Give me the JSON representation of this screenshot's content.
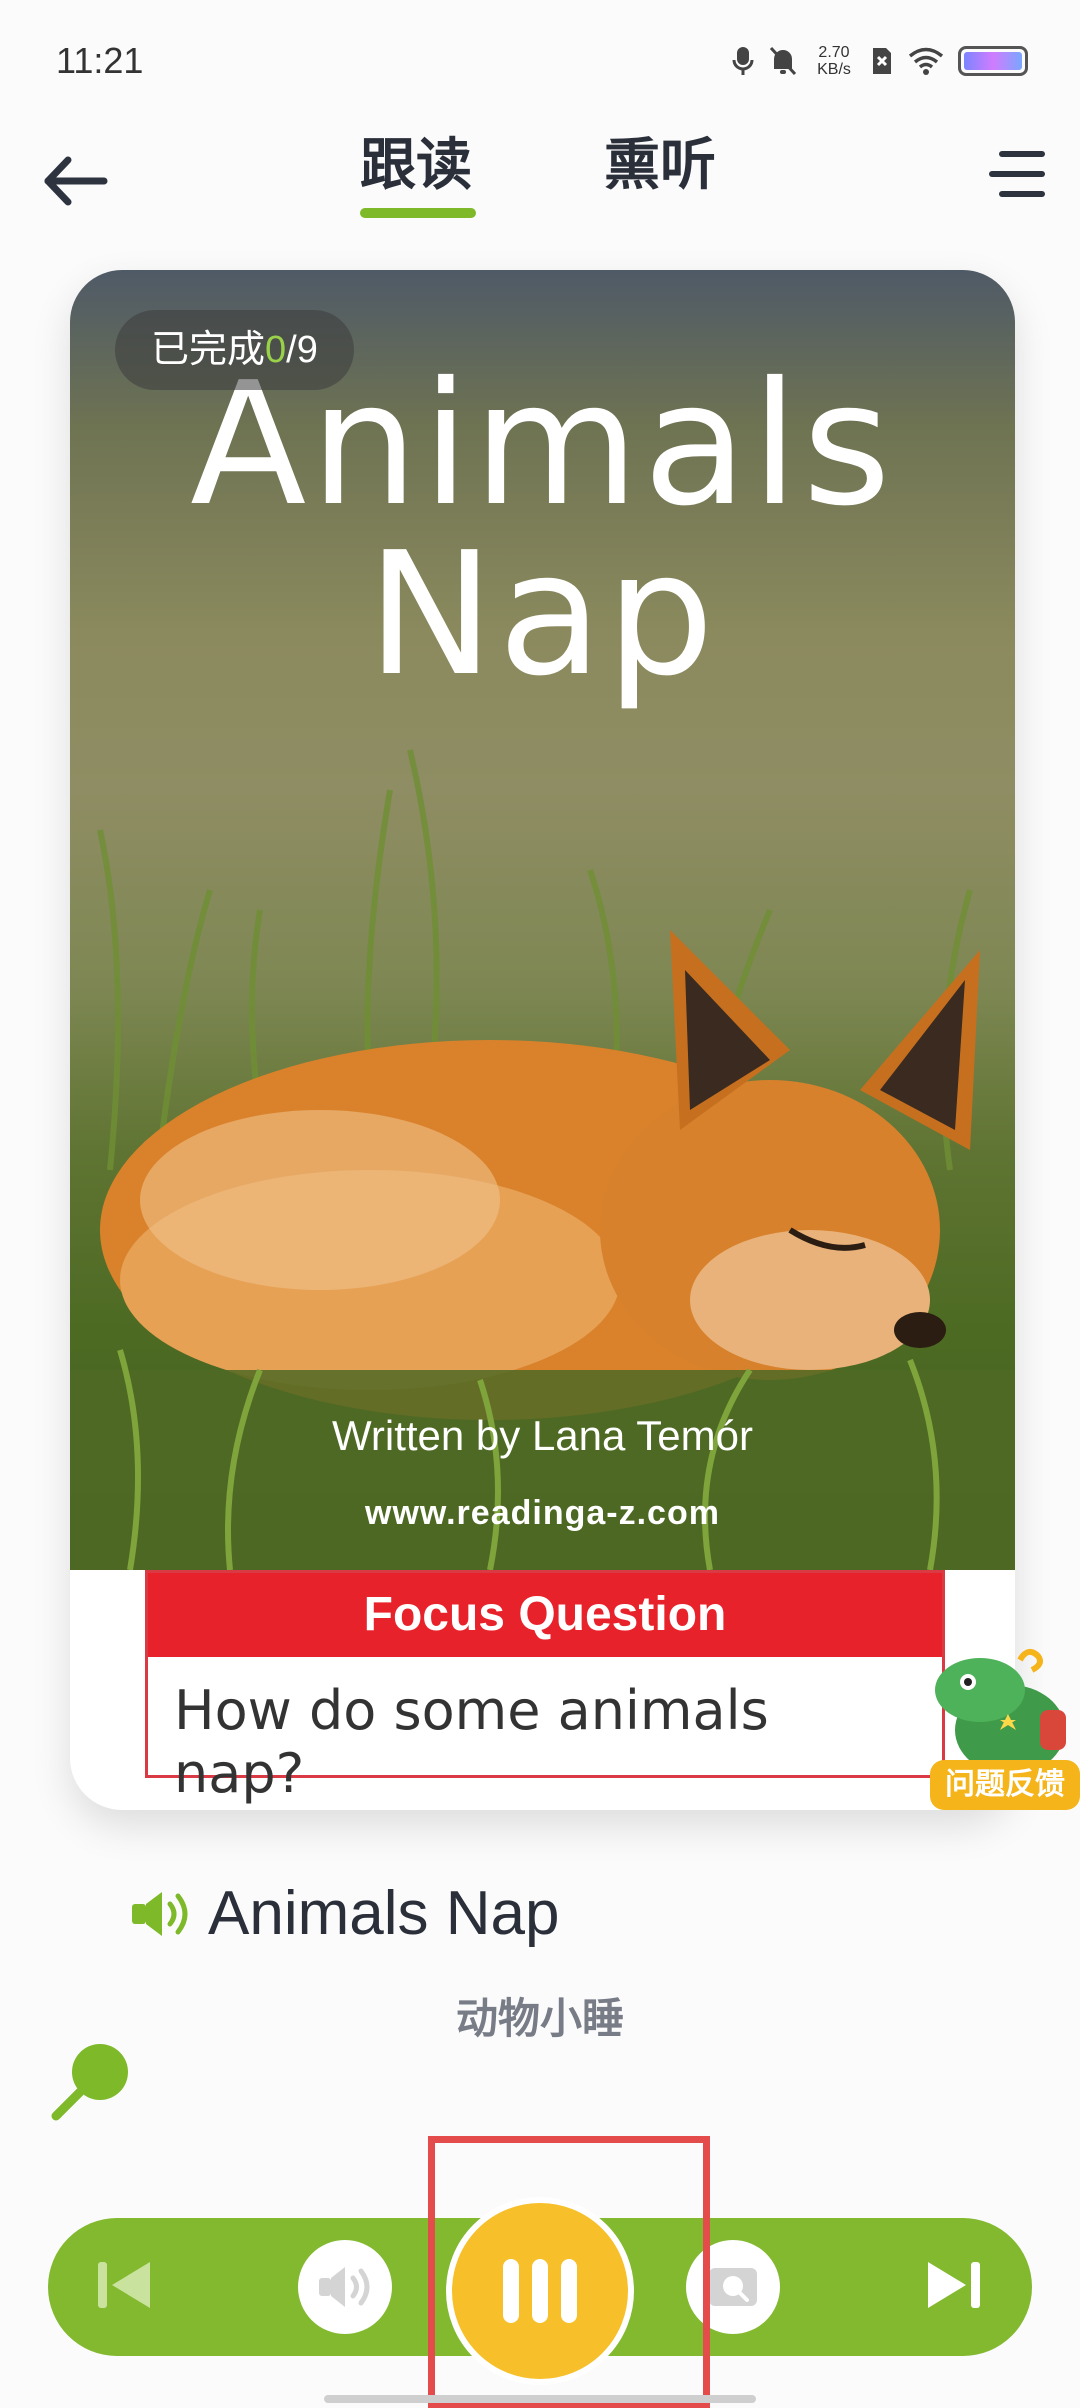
{
  "status_bar": {
    "time": "11:21",
    "net_speed_value": "2.70",
    "net_speed_unit": "KB/s",
    "icons": [
      "microphone-icon",
      "mute-bell-icon",
      "sim-off-icon",
      "wifi-icon",
      "battery-icon"
    ]
  },
  "header": {
    "tabs": [
      {
        "label": "跟读",
        "active": true
      },
      {
        "label": "熏听",
        "active": false
      }
    ],
    "accent_color": "#7db928"
  },
  "book": {
    "progress_prefix": "已完成",
    "progress_done": "0",
    "progress_total": "/9",
    "cover_title_line1": "Animals",
    "cover_title_line2": "Nap",
    "author": "Written by Lana Temór",
    "url": "www.readinga-z.com",
    "focus_heading": "Focus Question",
    "focus_question": "How do some animals nap?"
  },
  "feedback": {
    "label": "问题反馈"
  },
  "sentence": {
    "text": "Animals Nap",
    "translation": "动物小睡"
  },
  "player": {
    "bar_color": "#82b92f",
    "pause_color": "#f7c02a",
    "buttons": [
      "previous-icon",
      "audio-icon",
      "pause-icon",
      "record-icon",
      "next-icon"
    ]
  }
}
